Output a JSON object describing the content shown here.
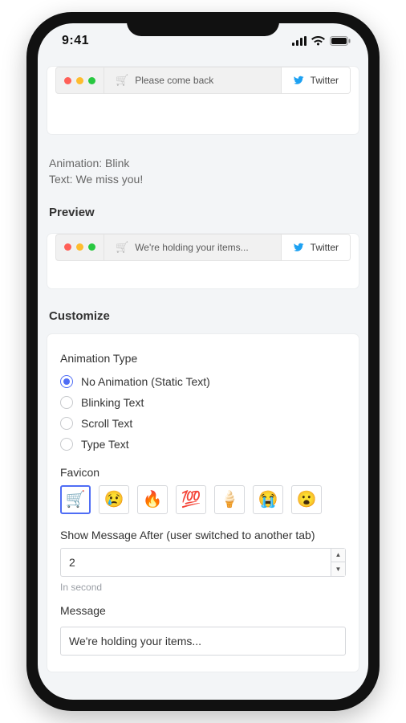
{
  "status": {
    "time": "9:41"
  },
  "preview1": {
    "tab_icon": "🛒",
    "tab_title": "Please come back",
    "other_tab": "Twitter",
    "caption_line1": "Animation: Blink",
    "caption_line2": "Text: We miss you!"
  },
  "labels": {
    "preview": "Preview",
    "customize": "Customize",
    "animation_type": "Animation Type",
    "favicon": "Favicon",
    "show_after": "Show Message After (user switched to another tab)",
    "in_second": "In second",
    "message": "Message"
  },
  "preview2": {
    "tab_icon": "🛒",
    "tab_title": "We're holding your items...",
    "other_tab": "Twitter"
  },
  "animation_options": [
    {
      "label": "No Animation (Static Text)",
      "checked": true
    },
    {
      "label": "Blinking Text",
      "checked": false
    },
    {
      "label": "Scroll Text",
      "checked": false
    },
    {
      "label": "Type Text",
      "checked": false
    }
  ],
  "favicons": [
    {
      "emoji": "🛒",
      "selected": true
    },
    {
      "emoji": "😢",
      "selected": false
    },
    {
      "emoji": "🔥",
      "selected": false
    },
    {
      "emoji": "💯",
      "selected": false
    },
    {
      "emoji": "🍦",
      "selected": false
    },
    {
      "emoji": "😭",
      "selected": false
    },
    {
      "emoji": "😮",
      "selected": false
    }
  ],
  "show_after_value": "2",
  "message_value": "We're holding your items..."
}
